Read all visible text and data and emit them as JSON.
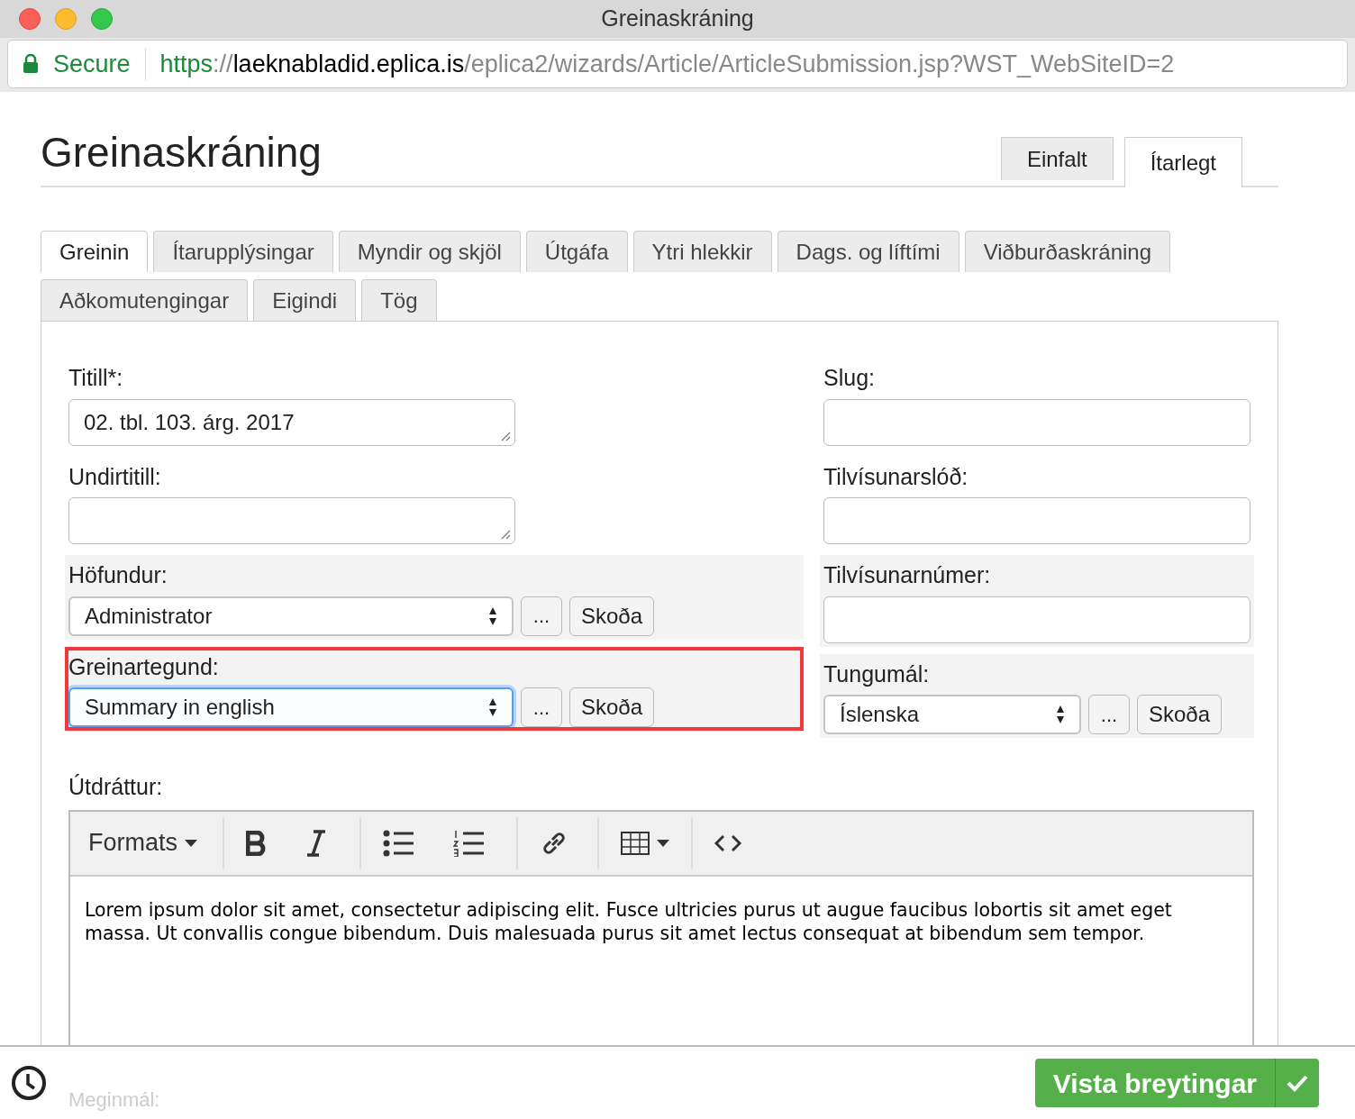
{
  "window": {
    "title": "Greinaskráning"
  },
  "address_bar": {
    "secure_label": "Secure",
    "url_scheme": "https",
    "url_sep": "://",
    "url_host": "laeknabladid.eplica.is",
    "url_path": "/eplica2/wizards/Article/ArticleSubmission.jsp?WST_WebSiteID=2"
  },
  "page_title": "Greinaskráning",
  "mode_tabs": [
    {
      "label": "Einfalt",
      "selected": false
    },
    {
      "label": "Ítarlegt",
      "selected": true
    }
  ],
  "tabs": [
    {
      "label": "Greinin",
      "selected": true
    },
    {
      "label": "Ítarupplýsingar",
      "selected": false
    },
    {
      "label": "Myndir og skjöl",
      "selected": false
    },
    {
      "label": "Útgáfa",
      "selected": false
    },
    {
      "label": "Ytri hlekkir",
      "selected": false
    },
    {
      "label": "Dags. og líftími",
      "selected": false
    },
    {
      "label": "Viðburðaskráning",
      "selected": false
    },
    {
      "label": "Aðkomutengingar",
      "selected": false
    },
    {
      "label": "Eigindi",
      "selected": false
    },
    {
      "label": "Tög",
      "selected": false
    }
  ],
  "left_fields": [
    {
      "kind": "textarea",
      "label": "Titill*:",
      "value": "02. tbl. 103. árg. 2017",
      "shaded": false,
      "highlighted": false
    },
    {
      "kind": "textarea",
      "label": "Undirtitill:",
      "shaded": false,
      "highlighted": false
    },
    {
      "kind": "select",
      "label": "Höfundur:",
      "value": "Administrator",
      "more": "...",
      "view": "Skoða",
      "shaded": true,
      "highlighted": false,
      "focused": false
    },
    {
      "kind": "select",
      "label": "Greinartegund:",
      "value": "Summary in english",
      "more": "...",
      "view": "Skoða",
      "shaded": true,
      "highlighted": true,
      "focused": true
    }
  ],
  "right_fields": [
    {
      "kind": "input",
      "label": "Slug:",
      "shaded": false,
      "highlighted": false
    },
    {
      "kind": "input",
      "label": "Tilvísunarslóð:",
      "shaded": false,
      "highlighted": false
    },
    {
      "kind": "input",
      "label": "Tilvísunarnúmer:",
      "shaded": true,
      "highlighted": false
    },
    {
      "kind": "select",
      "label": "Tungumál:",
      "value": "Íslenska",
      "more": "...",
      "view": "Skoða",
      "shaded": true,
      "highlighted": false,
      "focused": false
    }
  ],
  "editor": {
    "label": "Útdráttur:",
    "formats": "Formats",
    "content": "Lorem ipsum dolor sit amet, consectetur adipiscing elit. Fusce ultricies purus ut augue faucibus lobortis sit amet eget massa. Ut convallis congue bibendum. Duis malesuada purus sit amet lectus consequat at bibendum sem tempor."
  },
  "next_label": "Meginmál:",
  "save_button": "Vista breytingar"
}
